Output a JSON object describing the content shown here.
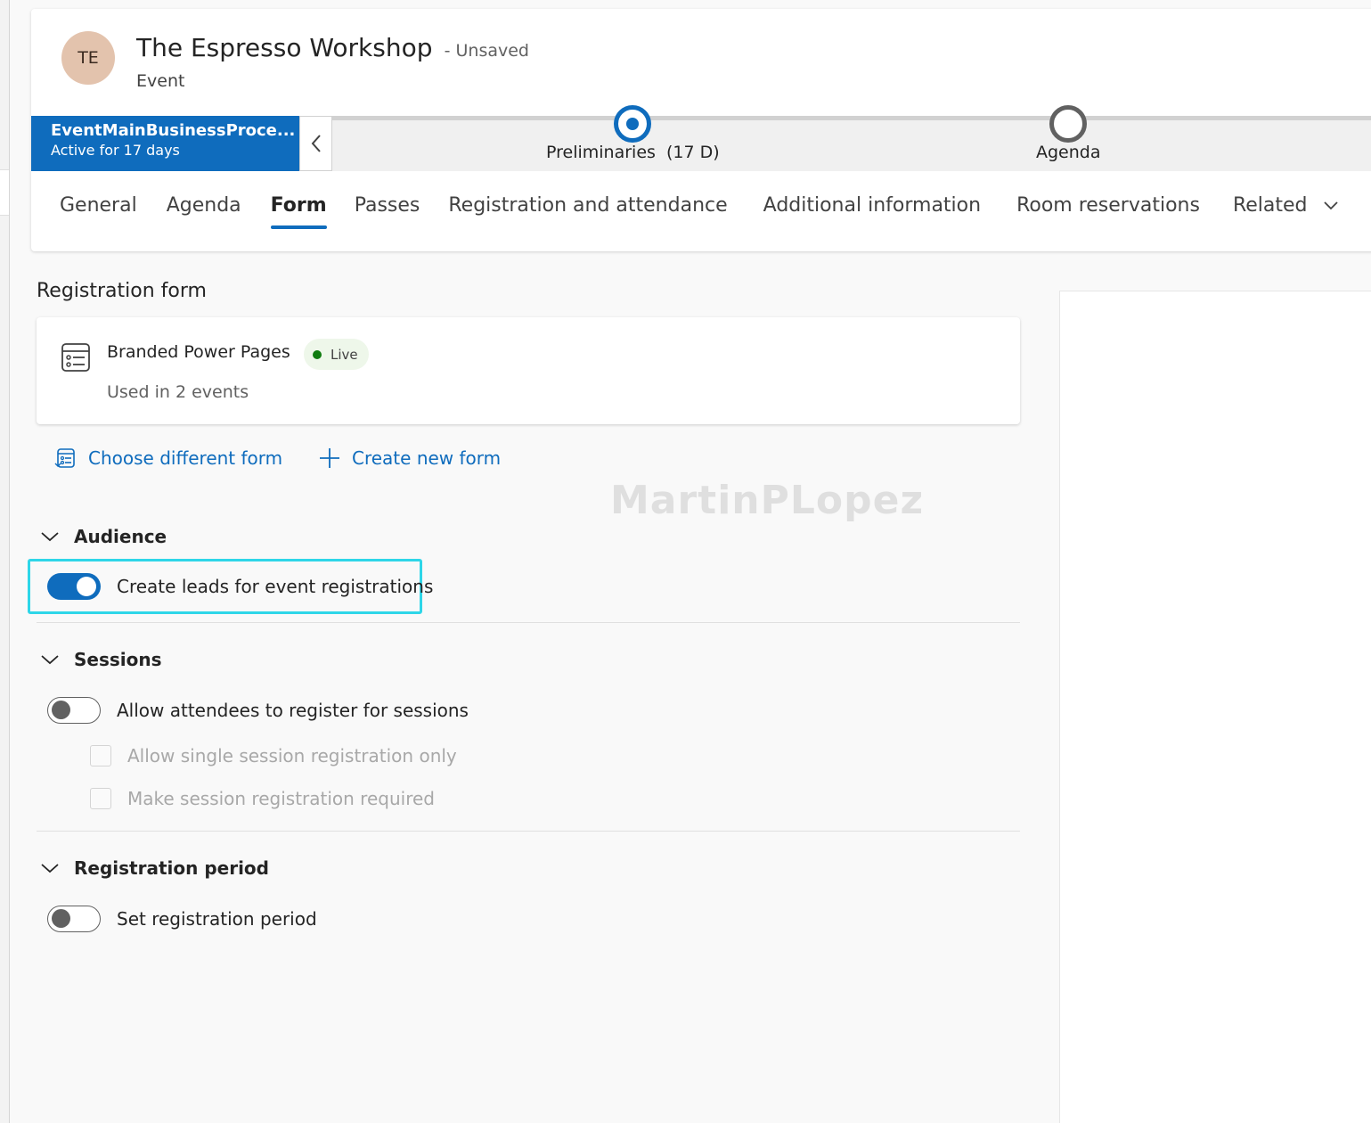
{
  "record": {
    "initials": "TE",
    "title": "The Espresso Workshop",
    "unsaved": "- Unsaved",
    "entity": "Event"
  },
  "bpf": {
    "process_name": "EventMainBusinessProce...",
    "active_for": "Active for 17 days",
    "stages": [
      {
        "name": "Preliminaries",
        "duration": "(17 D)",
        "status": "current"
      },
      {
        "name": "Agenda",
        "status": "next"
      }
    ]
  },
  "tabs": [
    {
      "label": "General"
    },
    {
      "label": "Agenda"
    },
    {
      "label": "Form",
      "selected": true
    },
    {
      "label": "Passes"
    },
    {
      "label": "Registration and attendance"
    },
    {
      "label": "Additional information"
    },
    {
      "label": "Room reservations"
    },
    {
      "label": "Related",
      "has_dropdown": true
    }
  ],
  "registration_form": {
    "section_title": "Registration form",
    "form_name": "Branded Power Pages",
    "status_badge": "Live",
    "usage": "Used in 2 events",
    "actions": {
      "choose": "Choose different form",
      "create": "Create new form"
    }
  },
  "watermark": "MartinPLopez",
  "audience": {
    "title": "Audience",
    "create_leads": {
      "label": "Create leads for event registrations",
      "on": true
    }
  },
  "sessions": {
    "title": "Sessions",
    "allow_register": {
      "label": "Allow attendees to register for sessions",
      "on": false
    },
    "single_only": {
      "label": "Allow single session registration only",
      "checked": false,
      "disabled": true
    },
    "required": {
      "label": "Make session registration required",
      "checked": false,
      "disabled": true
    }
  },
  "registration_period": {
    "title": "Registration period",
    "set_period": {
      "label": "Set registration period",
      "on": false
    }
  },
  "colors": {
    "accent": "#0f6cbd",
    "highlight": "#2ed6e8",
    "live": "#107c10",
    "avatar": "#e3c3ad"
  }
}
